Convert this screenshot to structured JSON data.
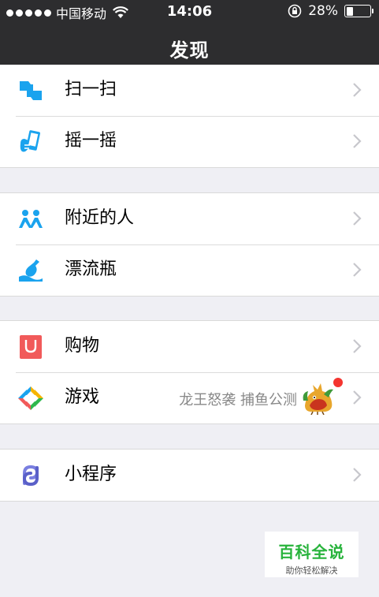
{
  "status_bar": {
    "carrier": "中国移动",
    "time": "14:06",
    "battery": "28%",
    "battery_level": 0.28
  },
  "nav": {
    "title": "发现"
  },
  "groups": [
    {
      "items": [
        {
          "label": "扫一扫",
          "icon": "scan-icon"
        },
        {
          "label": "摇一摇",
          "icon": "shake-icon"
        }
      ]
    },
    {
      "items": [
        {
          "label": "附近的人",
          "icon": "people-nearby-icon"
        },
        {
          "label": "漂流瓶",
          "icon": "drift-bottle-icon"
        }
      ]
    },
    {
      "items": [
        {
          "label": "购物",
          "icon": "shopping-icon"
        },
        {
          "label": "游戏",
          "icon": "games-icon",
          "extra": "龙王怒袭 捕鱼公测"
        }
      ]
    },
    {
      "items": [
        {
          "label": "小程序",
          "icon": "mini-program-icon"
        }
      ]
    }
  ],
  "watermark": {
    "title": "百科全说",
    "subtitle": "助你轻松解决"
  },
  "colors": {
    "nav_bg": "#2d2d2f",
    "page_bg": "#efeff4",
    "blue": "#1aa3ee",
    "red": "#f15a5a",
    "badge": "#f43530",
    "watermark_green": "#27b33b"
  }
}
